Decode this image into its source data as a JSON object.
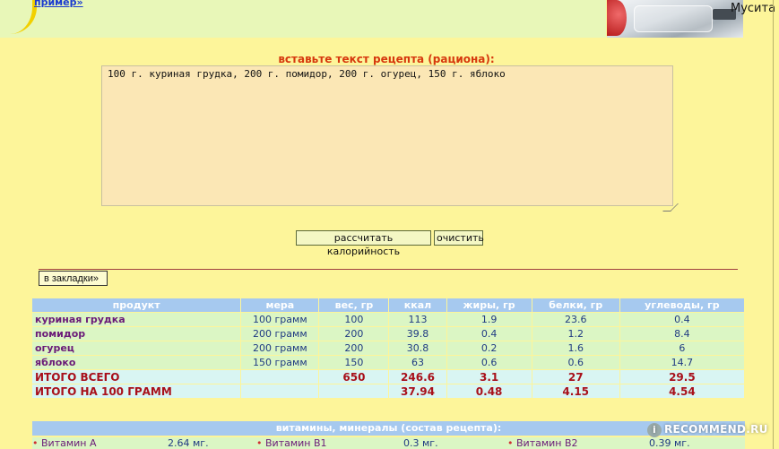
{
  "header": {
    "example_link": "пример»",
    "username": "Мусита"
  },
  "form": {
    "label": "вставьте текст рецепта (рациона):",
    "textarea_value": "100 г. куриная грудка, 200 г. помидор, 200 г. огурец, 150 г. яблоко",
    "calc_button": "рассчитать калорийность",
    "clear_button": "очистить",
    "bookmark_button": "в закладки»"
  },
  "table": {
    "headers": [
      "продукт",
      "мера",
      "вес, гр",
      "ккал",
      "жиры, гр",
      "белки, гр",
      "углеводы, гр"
    ],
    "rows": [
      [
        "куриная грудка",
        "100 грамм",
        "100",
        "113",
        "1.9",
        "23.6",
        "0.4"
      ],
      [
        "помидор",
        "200 грамм",
        "200",
        "39.8",
        "0.4",
        "1.2",
        "8.4"
      ],
      [
        "огурец",
        "200 грамм",
        "200",
        "30.8",
        "0.2",
        "1.6",
        "6"
      ],
      [
        "яблоко",
        "150 грамм",
        "150",
        "63",
        "0.6",
        "0.6",
        "14.7"
      ]
    ],
    "totals": [
      [
        "ИТОГО ВСЕГО",
        "",
        "650",
        "246.6",
        "3.1",
        "27",
        "29.5"
      ],
      [
        "ИТОГО НА 100 ГРАММ",
        "",
        "",
        "37.94",
        "0.48",
        "4.15",
        "4.54"
      ]
    ]
  },
  "vitamins": {
    "header": "витамины, минералы (состав рецепта):",
    "items": [
      {
        "name": "Витамин А",
        "value": "2.64 мг."
      },
      {
        "name": "Витамин В1",
        "value": "0.3 мг."
      },
      {
        "name": "Витамин В2",
        "value": "0.39 мг."
      }
    ]
  },
  "watermark": {
    "text": "RECOMMEND.RU",
    "badge": "i"
  },
  "colors": {
    "page_bg": "#fdf59a",
    "table_header": "#a6c9ef",
    "row_bg": "#dbf6c4",
    "total_bg": "#d9f5f3",
    "total_text": "#a8101a",
    "label_red": "#d6380d"
  }
}
